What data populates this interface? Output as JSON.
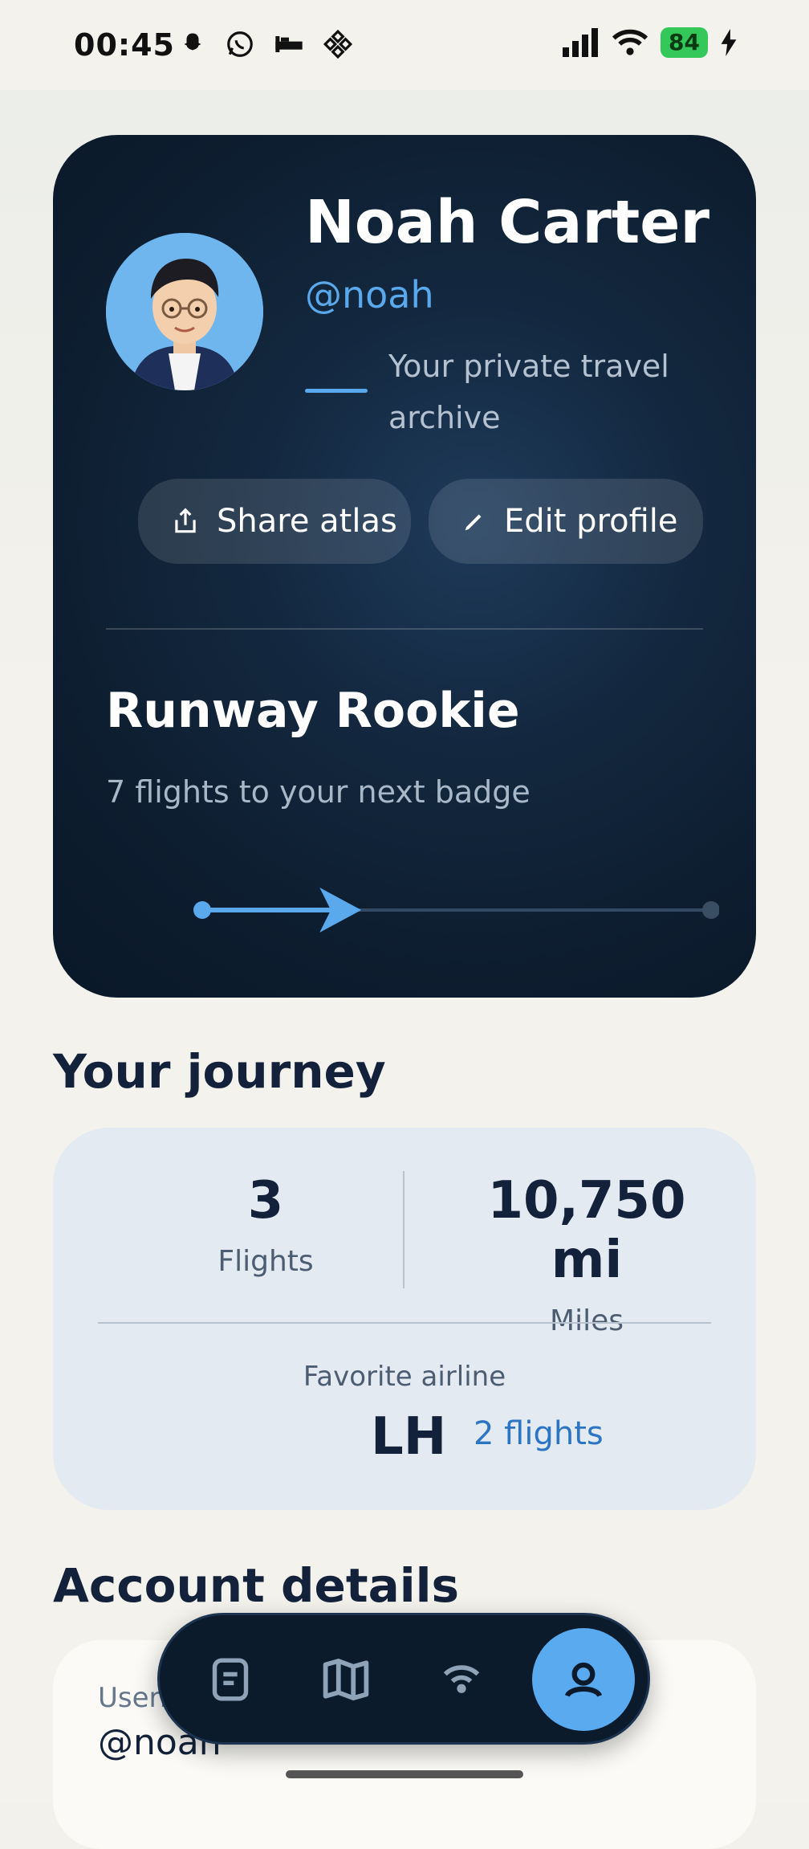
{
  "status_bar": {
    "time": "00:45",
    "left_icons": [
      "snapchat-icon",
      "whatsapp-icon",
      "bed-icon",
      "binance-icon"
    ],
    "right_icons": [
      "signal-icon",
      "wifi-icon",
      "battery-icon",
      "charging-icon"
    ],
    "battery": "84"
  },
  "profile": {
    "name": "Noah Carter",
    "handle": "@noah",
    "tagline": "Your private travel archive",
    "share_label": "Share atlas",
    "edit_label": "Edit profile",
    "badge_title": "Runway Rookie",
    "badge_subtitle": "7 flights to your next badge",
    "badge_progress": 0.3
  },
  "journey": {
    "title": "Your journey",
    "flights_value": "3",
    "flights_label": "Flights",
    "miles_value": "10,750 mi",
    "miles_label": "Miles",
    "favorite_label": "Favorite airline",
    "favorite_code": "LH",
    "favorite_count": "2 flights"
  },
  "account": {
    "title": "Account details",
    "username_label": "Username",
    "username_value": "@noah"
  },
  "nav": {
    "items": [
      "logbook-icon",
      "map-icon",
      "live-icon",
      "profile-icon"
    ],
    "active": "profile-icon"
  },
  "colors": {
    "accent": "#5aa9ec",
    "card_dark": "#0d1d2f",
    "journey_bg": "#e4eaf1",
    "link": "#2c74c4"
  }
}
